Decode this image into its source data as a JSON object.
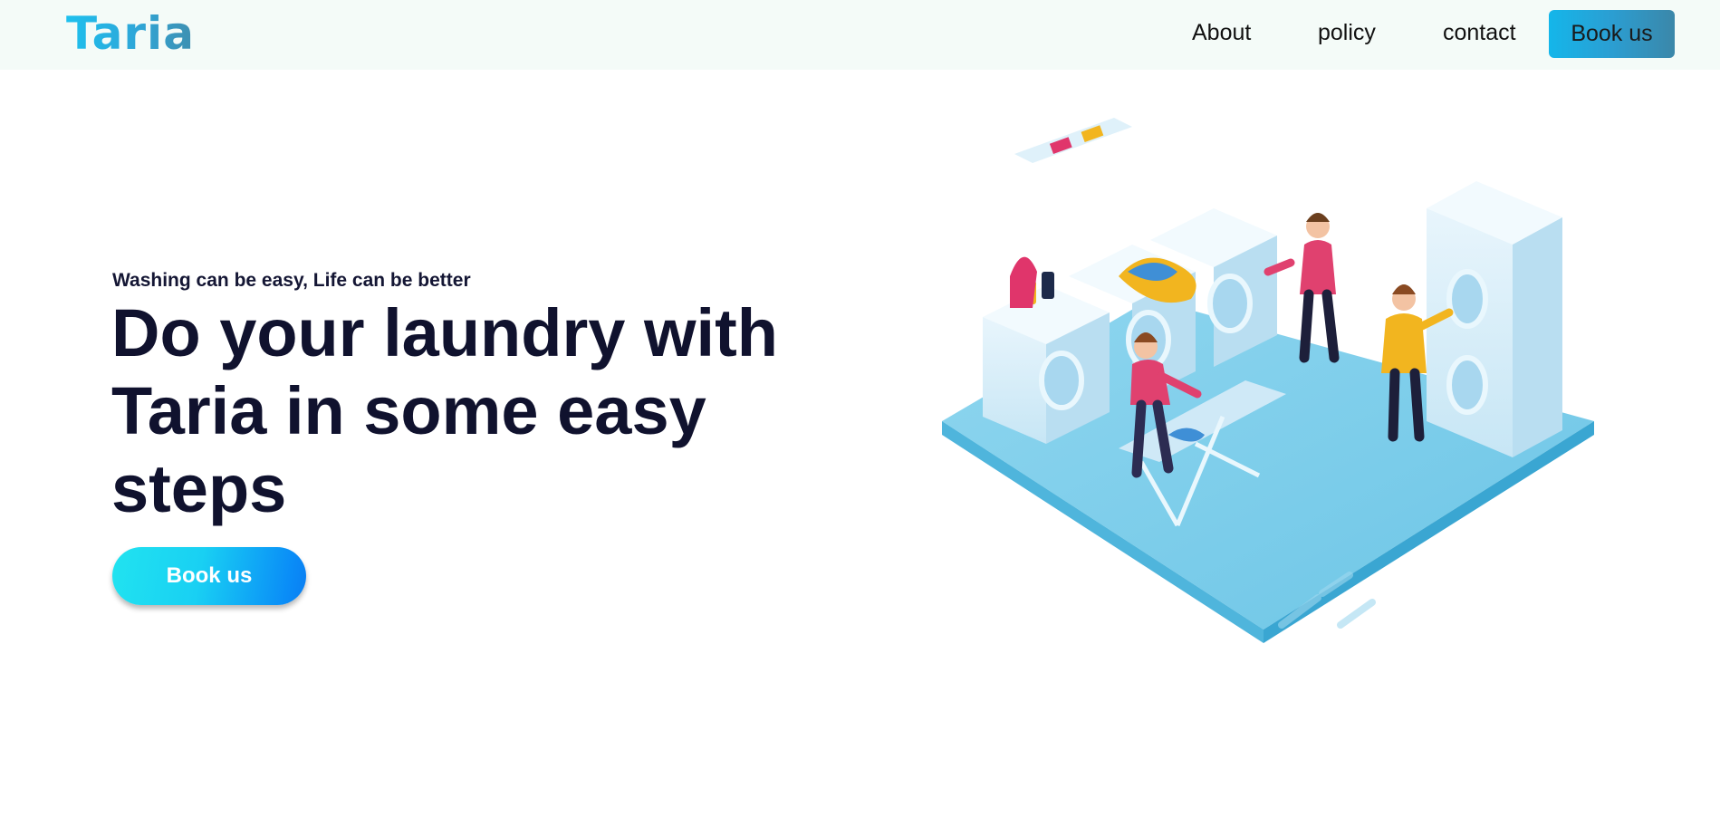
{
  "navbar": {
    "logo": "Taria",
    "links": [
      "About",
      "policy",
      "contact"
    ],
    "cta": "Book us"
  },
  "hero": {
    "tagline": "Washing can be easy, Life can be better",
    "headline": "Do your laundry with Taria in some easy steps",
    "cta": "Book us"
  },
  "colors": {
    "navbar_bg": "#f4fbf8",
    "headline": "#10122e",
    "accent_start": "#21e3f0",
    "accent_end": "#0b7ef2"
  }
}
